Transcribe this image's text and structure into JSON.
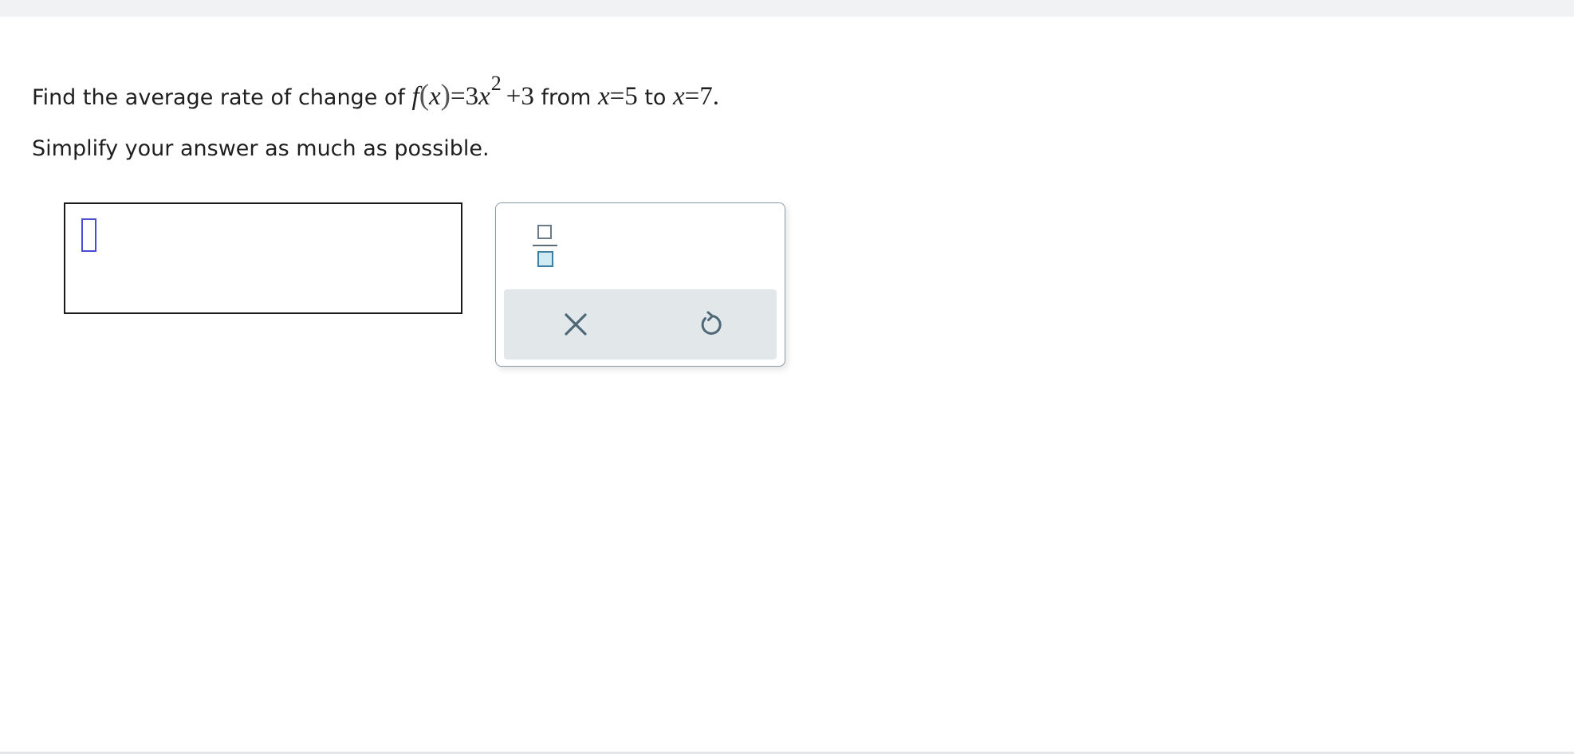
{
  "question": {
    "prefix": "Find the average rate of change of",
    "func_name": "f",
    "func_var": "x",
    "equals": "=",
    "coefficient": "3",
    "var": "x",
    "exponent": "2",
    "constant": "+3",
    "from_word": "from",
    "from_var": "x",
    "from_value": "5",
    "to_word": "to",
    "to_var": "x",
    "to_value": "7",
    "period": "."
  },
  "instruction": "Simplify your answer as much as possible.",
  "answer": {
    "value": ""
  },
  "palette": {
    "buttons": [
      {
        "name": "fraction",
        "icon": "fraction-icon"
      },
      {
        "name": "clear",
        "icon": "close-icon"
      },
      {
        "name": "undo",
        "icon": "undo-icon"
      }
    ],
    "colors": {
      "icon": "#4f6878",
      "fraction_fill": "#cfeaf3",
      "action_bar": "#e2e7ea",
      "cursor": "#4b4bd8"
    }
  }
}
